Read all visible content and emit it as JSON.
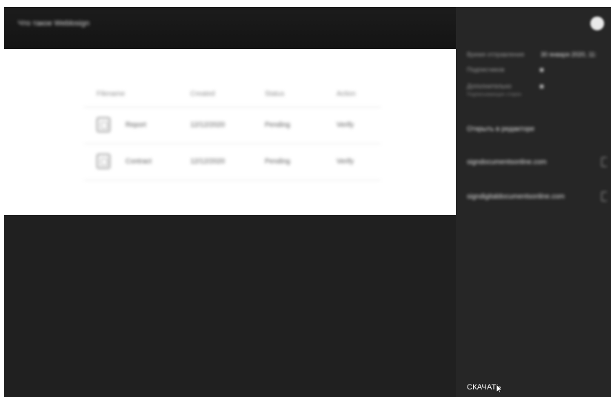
{
  "header": {
    "title": "Что такое Weblosign"
  },
  "table": {
    "columns": [
      "Filename",
      "Created",
      "Status",
      "Action"
    ],
    "rows": [
      {
        "icon": "file-icon",
        "name": "Report",
        "created": "12/12/2020",
        "status": "Pending",
        "action": "Verify"
      },
      {
        "icon": "file-icon",
        "name": "Contract",
        "created": "12/12/2020",
        "status": "Pending",
        "action": "Verify"
      }
    ]
  },
  "panel": {
    "meta": {
      "date_label": "Время отправления",
      "date_value": "30 января 2020, 11:",
      "row2_label": "Подписчиков",
      "row3_label": "Дополнительно",
      "row3_sub": "Подписывающих сторон"
    },
    "links": {
      "open_in_editor": "Открыть в редакторе",
      "link1": "signdocumentsonline.com",
      "link2": "signdigitaldocumentsonline.com"
    },
    "download_label": "СКАЧАТЬ"
  },
  "colors": {
    "background": "#212121",
    "content": "#ffffff",
    "panel": "#262626"
  }
}
